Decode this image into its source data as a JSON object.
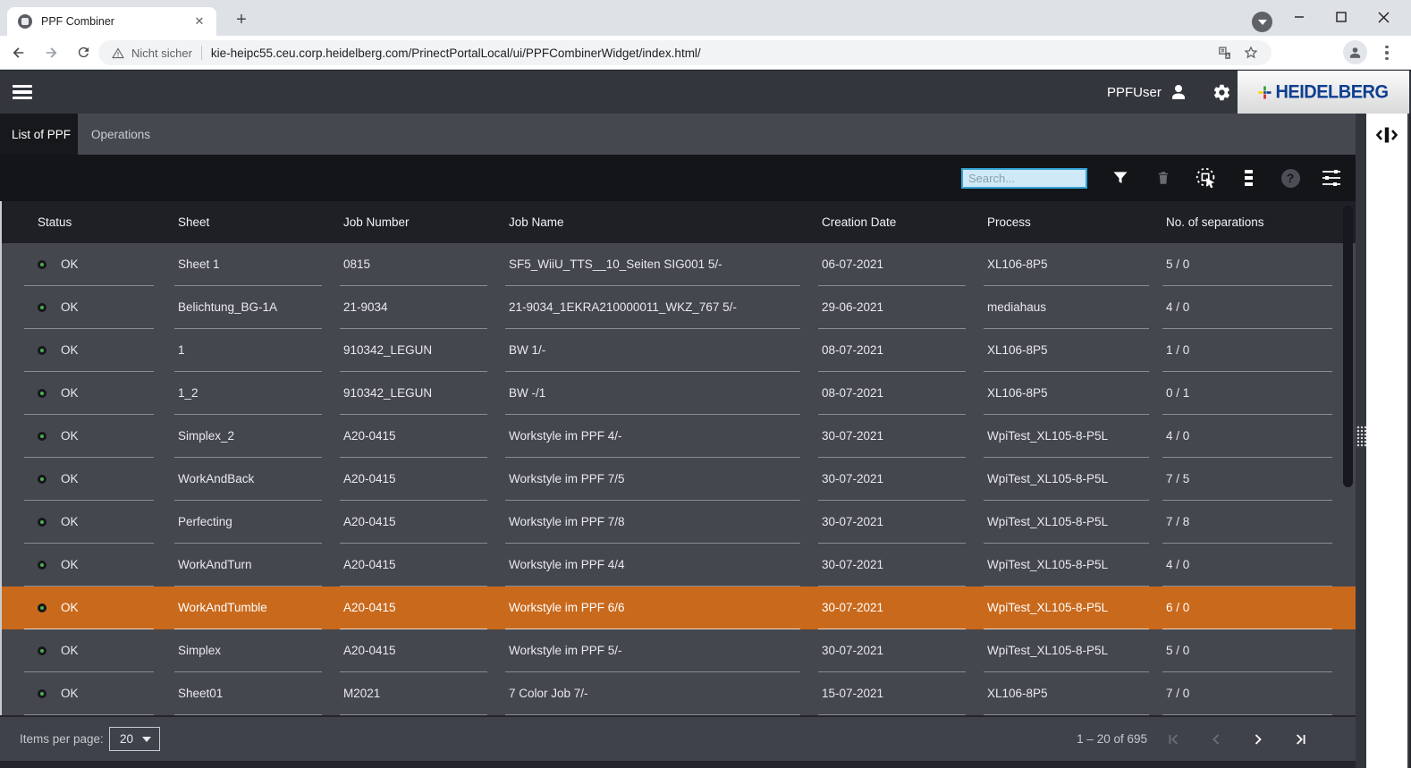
{
  "browser": {
    "tab_title": "PPF Combiner",
    "new_tab": "+",
    "security_warning": "Nicht sicher",
    "url": "kie-heipc55.ceu.corp.heidelberg.com/PrinectPortalLocal/ui/PPFCombinerWidget/index.html/"
  },
  "header": {
    "user_name": "PPFUser",
    "brand": "HEIDELBERG"
  },
  "tabs": {
    "list_of_ppf": "List of PPF",
    "operations": "Operations"
  },
  "toolbar": {
    "search_placeholder": "Search..."
  },
  "table": {
    "columns": [
      "Status",
      "Sheet",
      "Job Number",
      "Job Name",
      "Creation Date",
      "Process",
      "No. of separations"
    ],
    "rows": [
      {
        "status": "OK",
        "sheet": "Sheet 1",
        "job_number": "0815",
        "job_name": "SF5_WiiU_TTS__10_Seiten SIG001 5/-",
        "creation_date": "06-07-2021",
        "process": "XL106-8P5",
        "separations": "5 / 0",
        "selected": false
      },
      {
        "status": "OK",
        "sheet": "Belichtung_BG-1A",
        "job_number": "21-9034",
        "job_name": "21-9034_1EKRA210000011_WKZ_767 5/-",
        "creation_date": "29-06-2021",
        "process": "mediahaus",
        "separations": "4 / 0",
        "selected": false
      },
      {
        "status": "OK",
        "sheet": "1",
        "job_number": "910342_LEGUN",
        "job_name": "BW 1/-",
        "creation_date": "08-07-2021",
        "process": "XL106-8P5",
        "separations": "1 / 0",
        "selected": false
      },
      {
        "status": "OK",
        "sheet": "1_2",
        "job_number": "910342_LEGUN",
        "job_name": "BW -/1",
        "creation_date": "08-07-2021",
        "process": "XL106-8P5",
        "separations": "0 / 1",
        "selected": false
      },
      {
        "status": "OK",
        "sheet": "Simplex_2",
        "job_number": "A20-0415",
        "job_name": "Workstyle im PPF 4/-",
        "creation_date": "30-07-2021",
        "process": "WpiTest_XL105-8-P5L",
        "separations": "4 / 0",
        "selected": false
      },
      {
        "status": "OK",
        "sheet": "WorkAndBack",
        "job_number": "A20-0415",
        "job_name": "Workstyle im PPF 7/5",
        "creation_date": "30-07-2021",
        "process": "WpiTest_XL105-8-P5L",
        "separations": "7 / 5",
        "selected": false
      },
      {
        "status": "OK",
        "sheet": "Perfecting",
        "job_number": "A20-0415",
        "job_name": "Workstyle im PPF 7/8",
        "creation_date": "30-07-2021",
        "process": "WpiTest_XL105-8-P5L",
        "separations": "7 / 8",
        "selected": false
      },
      {
        "status": "OK",
        "sheet": "WorkAndTurn",
        "job_number": "A20-0415",
        "job_name": "Workstyle im PPF 4/4",
        "creation_date": "30-07-2021",
        "process": "WpiTest_XL105-8-P5L",
        "separations": "4 / 0",
        "selected": false
      },
      {
        "status": "OK",
        "sheet": "WorkAndTumble",
        "job_number": "A20-0415",
        "job_name": "Workstyle im PPF 6/6",
        "creation_date": "30-07-2021",
        "process": "WpiTest_XL105-8-P5L",
        "separations": "6 / 0",
        "selected": true
      },
      {
        "status": "OK",
        "sheet": "Simplex",
        "job_number": "A20-0415",
        "job_name": "Workstyle im PPF 5/-",
        "creation_date": "30-07-2021",
        "process": "WpiTest_XL105-8-P5L",
        "separations": "5 / 0",
        "selected": false
      },
      {
        "status": "OK",
        "sheet": "Sheet01",
        "job_number": "M2021",
        "job_name": "7 Color Job 7/-",
        "creation_date": "15-07-2021",
        "process": "XL106-8P5",
        "separations": "7 / 0",
        "selected": false
      }
    ]
  },
  "footer": {
    "items_per_page_label": "Items per page:",
    "items_per_page_value": "20",
    "range_label": "1 – 20 of 695",
    "paginator": {
      "first": false,
      "prev": false,
      "next": true,
      "last": true
    }
  },
  "colors": {
    "selected_row": "#C9691C",
    "status_ok": "#4CAF50",
    "search_border": "#35A3D6",
    "brand_blue": "#0E3F92"
  }
}
